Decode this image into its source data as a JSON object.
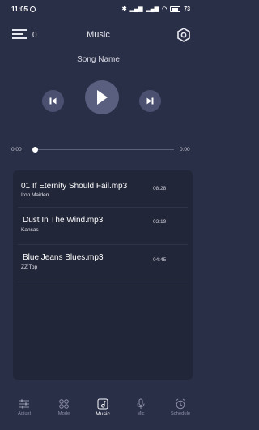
{
  "status_bar": {
    "time": "11:05",
    "battery": "73"
  },
  "header": {
    "count": "0",
    "title": "Music"
  },
  "player": {
    "song_name": "Song Name",
    "elapsed": "0:00",
    "duration": "0:00",
    "progress": 0
  },
  "playlist": [
    {
      "title": "01 If Eternity Should Fail.mp3",
      "artist": "Iron Maiden",
      "duration": "08:28"
    },
    {
      "title": "Dust In The Wind.mp3",
      "artist": "Kansas",
      "duration": "03:19"
    },
    {
      "title": "Blue Jeans Blues.mp3",
      "artist": "ZZ Top",
      "duration": "04:45"
    }
  ],
  "nav": [
    {
      "label": "Adjust",
      "icon": "sliders-icon"
    },
    {
      "label": "Mode",
      "icon": "grid-icon"
    },
    {
      "label": "Music",
      "icon": "music-note-icon",
      "active": true
    },
    {
      "label": "Mic",
      "icon": "microphone-icon"
    },
    {
      "label": "Schedule",
      "icon": "alarm-clock-icon"
    }
  ],
  "colors": {
    "background": "#2a2f48",
    "panel": "#222639",
    "button": "#4b5070",
    "inactive_nav": "#8d90a6"
  }
}
